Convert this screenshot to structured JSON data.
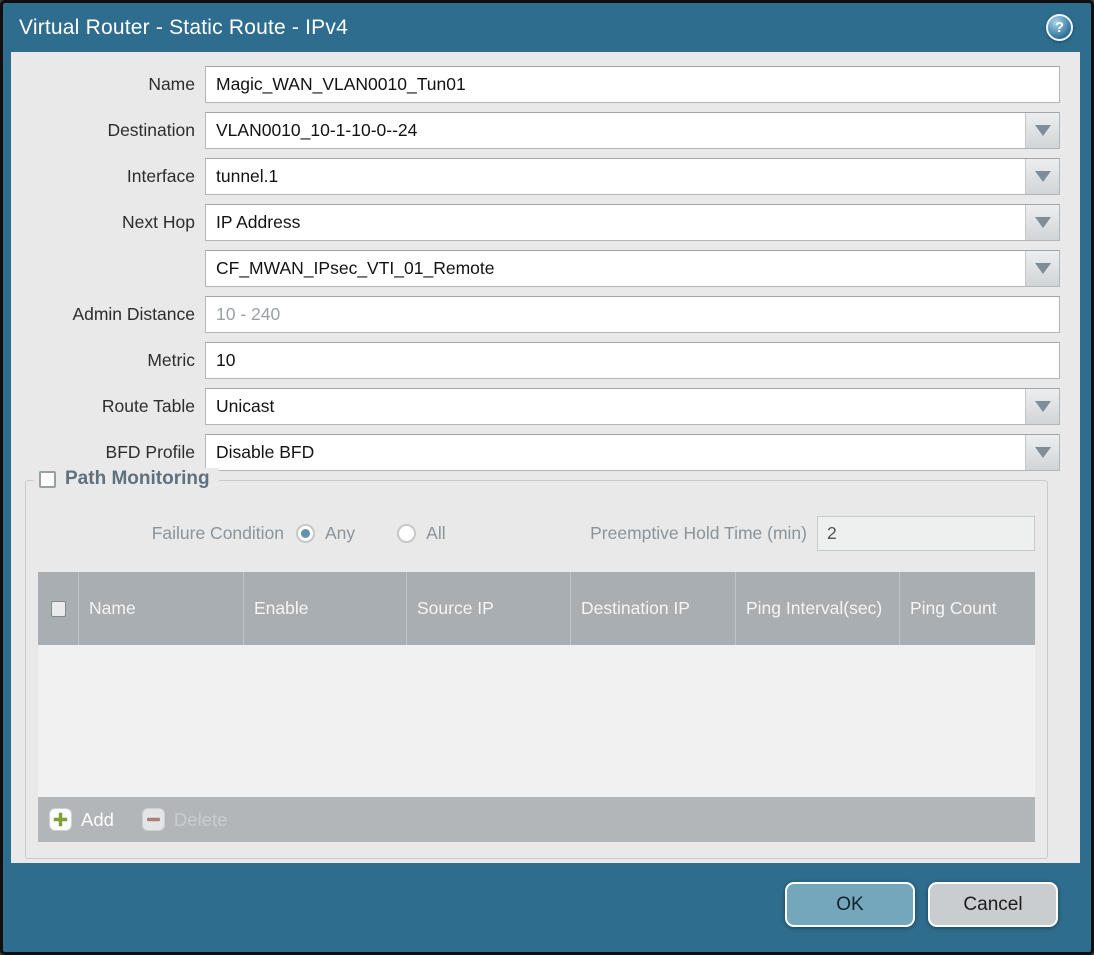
{
  "window": {
    "title": "Virtual Router - Static Route - IPv4",
    "help_glyph": "?"
  },
  "form": {
    "fields": [
      {
        "label": "Name",
        "value": "Magic_WAN_VLAN0010_Tun01"
      },
      {
        "label": "Destination",
        "value": "VLAN0010_10-1-10-0--24"
      },
      {
        "label": "Interface",
        "value": "tunnel.1"
      },
      {
        "label": "Next Hop",
        "value": "IP Address"
      },
      {
        "label": "",
        "value": "CF_MWAN_IPsec_VTI_01_Remote"
      },
      {
        "label": "Admin Distance",
        "value": "",
        "placeholder": "10 - 240"
      },
      {
        "label": "Metric",
        "value": "10"
      },
      {
        "label": "Route Table",
        "value": "Unicast"
      },
      {
        "label": "BFD Profile",
        "value": "Disable BFD"
      }
    ]
  },
  "path_monitoring": {
    "title": "Path Monitoring",
    "checked": false,
    "failure_condition": {
      "label": "Failure Condition",
      "options": [
        {
          "label": "Any",
          "selected": true
        },
        {
          "label": "All",
          "selected": false
        }
      ]
    },
    "preemptive_hold_time": {
      "label": "Preemptive Hold Time (min)",
      "value": "2"
    },
    "table": {
      "columns": [
        "Name",
        "Enable",
        "Source IP",
        "Destination IP",
        "Ping Interval(sec)",
        "Ping Count"
      ],
      "rows": [],
      "add_label": "Add",
      "delete_label": "Delete"
    }
  },
  "footer": {
    "ok_label": "OK",
    "cancel_label": "Cancel"
  },
  "colors": {
    "titlebar_teal": "#2e6d8d",
    "panel_gray": "#e9e9e9",
    "table_header_gray": "#a9aeb2",
    "ok_button_blue": "#74a6bc",
    "add_icon_green": "#7ea039",
    "delete_icon_red": "#aa6f63"
  }
}
